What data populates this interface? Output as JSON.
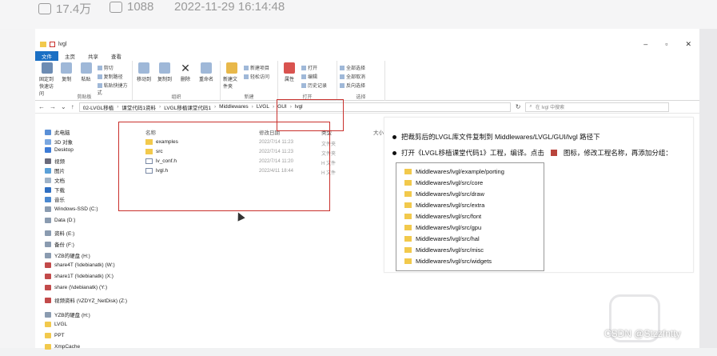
{
  "video_stats": {
    "plays": "17.4万",
    "danmaku": "1088",
    "datetime": "2022-11-29 16:14:48"
  },
  "window": {
    "title": "lvgl",
    "tabs": [
      "文件",
      "主页",
      "共享",
      "查看"
    ],
    "ribbon": {
      "clipboard": {
        "buttons": [
          "固定到快速访问",
          "复制",
          "粘贴"
        ],
        "small": [
          "剪切",
          "复制路径",
          "粘贴快捷方式"
        ],
        "label": "剪贴板"
      },
      "organize": {
        "buttons": [
          "移动到",
          "复制到",
          "删除",
          "重命名"
        ],
        "label": "组织"
      },
      "new": {
        "buttons": [
          "新建文件夹"
        ],
        "small": [
          "新建项目",
          "轻松访问"
        ],
        "label": "新建"
      },
      "open": {
        "buttons": [
          "属性"
        ],
        "small": [
          "打开",
          "编辑",
          "历史记录"
        ],
        "label": "打开"
      },
      "select": {
        "small": [
          "全部选择",
          "全部取消",
          "反向选择"
        ],
        "label": "选择"
      },
      "banner": "正点原子官方"
    },
    "address": {
      "crumbs": [
        "02-LVGL移植",
        "课堂代码1资料",
        "LVGL移植课堂代码1",
        "Middlewares",
        "LVGL",
        "GUI",
        "lvgl"
      ],
      "search_placeholder": "在 lvgl 中搜索"
    },
    "nav_items": [
      "此电脑",
      "3D 对象",
      "Desktop",
      "视频",
      "图片",
      "文档",
      "下载",
      "音乐",
      "Windows-SSD (C:)",
      "Data (D:)",
      "资料 (E:)",
      "备份 (F:)",
      "YZB的硬盘 (H:)",
      "share4T (\\\\debianatk) (W:)",
      "share1T (\\\\debianatk) (X:)",
      "share (\\\\debianatk) (Y:)",
      "视频资料 (\\\\ZDYZ_NetDisk) (Z:)",
      "YZB的硬盘 (H:)",
      "LVGL",
      "PPT",
      "XmpCache"
    ],
    "columns": {
      "name": "名称",
      "date": "修改日期",
      "type": "类型",
      "size": "大小"
    },
    "files": [
      {
        "name": "examples",
        "date": "2022/7/14 11:23",
        "type": "文件夹",
        "kind": "folder"
      },
      {
        "name": "src",
        "date": "2022/7/14 11:23",
        "type": "文件夹",
        "kind": "folder"
      },
      {
        "name": "lv_conf.h",
        "date": "2022/7/14 11:20",
        "type": "H 文件",
        "kind": "file"
      },
      {
        "name": "lvgl.h",
        "date": "2022/4/11 18:44",
        "type": "H 文件",
        "kind": "file"
      }
    ]
  },
  "note": {
    "line1": "把裁剪后的LVGL库文件复制到 Middlewares/LVGL/GUI/lvgl 路径下",
    "line2_a": "打开《LVGL移植课堂代码1》工程，编译。点击",
    "line2_b": "图标，修改工程名称，再添加分组：",
    "paths": [
      "Middlewares/lvgl/example/porting",
      "Middlewares/lvgl/src/core",
      "Middlewares/lvgl/src/draw",
      "Middlewares/lvgl/src/extra",
      "Middlewares/lvgl/src/font",
      "Middlewares/lvgl/src/gpu",
      "Middlewares/lvgl/src/hal",
      "Middlewares/lvgl/src/misc",
      "Middlewares/lvgl/src/widgets"
    ]
  },
  "watermark": "CSDN @Stzzfntty",
  "colors": {
    "accent": "#1a6fc4",
    "highlight": "#c9302c",
    "folder": "#f2c94c"
  }
}
